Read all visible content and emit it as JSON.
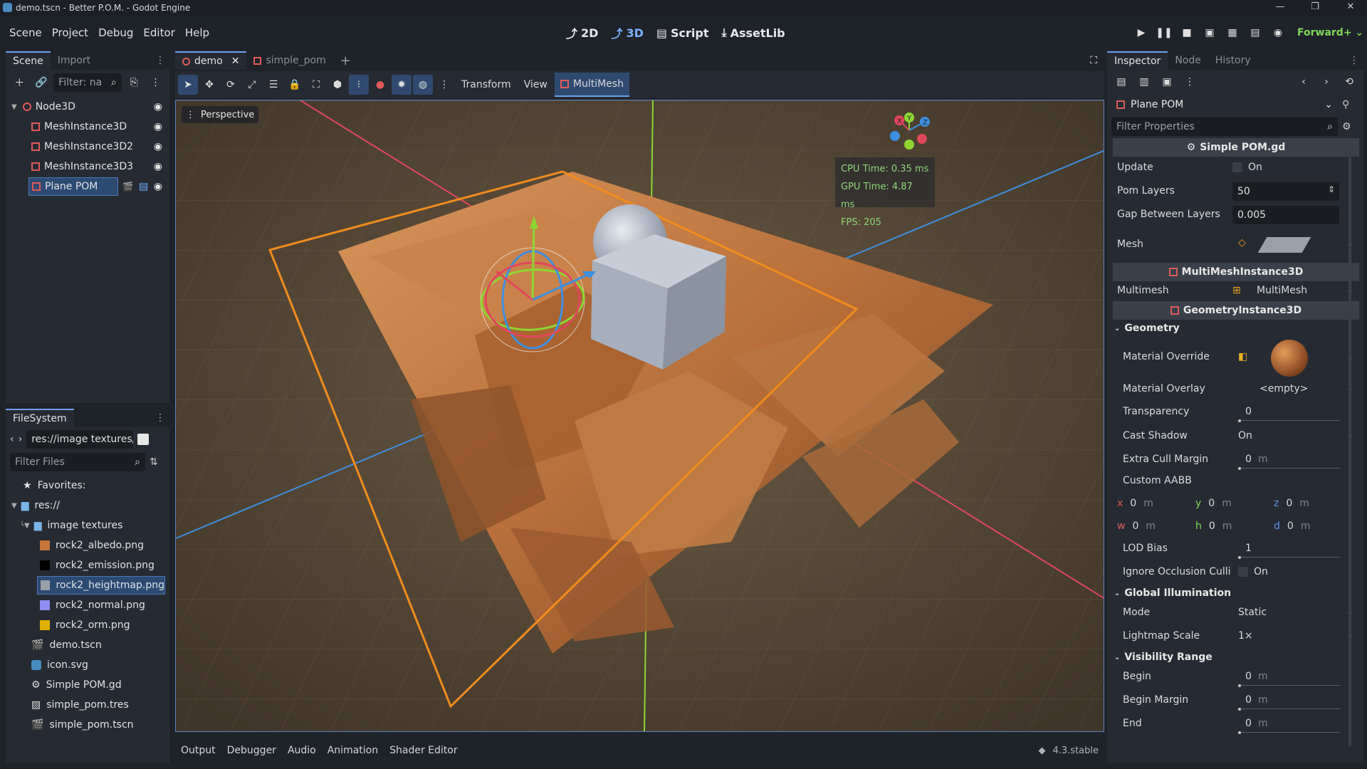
{
  "window": {
    "title": "demo.tscn - Better P.O.M. - Godot Engine"
  },
  "menu": [
    "Scene",
    "Project",
    "Debug",
    "Editor",
    "Help"
  ],
  "workspaces": [
    {
      "label": "2D",
      "active": false
    },
    {
      "label": "3D",
      "active": true
    },
    {
      "label": "Script",
      "active": false
    },
    {
      "label": "AssetLib",
      "active": false
    }
  ],
  "renderer": "Forward+",
  "scene_dock": {
    "tabs": [
      "Scene",
      "Import"
    ],
    "filter_placeholder": "Filter: na",
    "tree": [
      {
        "label": "Node3D",
        "icon": "node3d-icon"
      },
      {
        "label": "MeshInstance3D",
        "icon": "mesh-instance-icon"
      },
      {
        "label": "MeshInstance3D2",
        "icon": "mesh-instance-icon"
      },
      {
        "label": "MeshInstance3D3",
        "icon": "mesh-instance-icon"
      },
      {
        "label": "Plane POM",
        "icon": "multimesh-instance-icon",
        "selected": true
      }
    ]
  },
  "filesystem": {
    "tab": "FileSystem",
    "path": "res://image textures/r",
    "filter_placeholder": "Filter Files",
    "favorites": "Favorites:",
    "root": "res://",
    "folder": "image textures",
    "files": [
      {
        "label": "rock2_albedo.png",
        "icon": "texture-albedo-icon",
        "color": "#c5743a"
      },
      {
        "label": "rock2_emission.png",
        "icon": "texture-emission-icon",
        "color": "#000000"
      },
      {
        "label": "rock2_heightmap.png",
        "icon": "texture-heightmap-icon",
        "color": "#9aa0a8",
        "selected": true
      },
      {
        "label": "rock2_normal.png",
        "icon": "texture-normal-icon",
        "color": "#8f8cf2"
      },
      {
        "label": "rock2_orm.png",
        "icon": "texture-orm-icon",
        "color": "#e0b000"
      }
    ],
    "root_files": [
      {
        "label": "demo.tscn",
        "icon": "scene-file-icon"
      },
      {
        "label": "icon.svg",
        "icon": "svg-file-icon"
      },
      {
        "label": "Simple POM.gd",
        "icon": "gear-icon"
      },
      {
        "label": "simple_pom.tres",
        "icon": "resource-file-icon"
      },
      {
        "label": "simple_pom.tscn",
        "icon": "scene-file-icon"
      }
    ]
  },
  "editor_tabs": [
    {
      "label": "demo",
      "active": true
    },
    {
      "label": "simple_pom",
      "active": false
    }
  ],
  "viewport_toolbar": {
    "menus": [
      "Transform",
      "View"
    ],
    "multimesh": "MultiMesh"
  },
  "viewport": {
    "label": "Perspective",
    "stats": [
      "CPU Time: 0.35 ms",
      "GPU Time: 4.87 ms",
      "FPS: 205"
    ],
    "gizmo_axes": [
      "Y",
      "Z",
      "X"
    ]
  },
  "bottom_panel": {
    "tabs": [
      "Output",
      "Debugger",
      "Audio",
      "Animation",
      "Shader Editor"
    ],
    "version": "4.3.stable"
  },
  "inspector": {
    "tabs": [
      "Inspector",
      "Node",
      "History"
    ],
    "object": "Plane POM",
    "filter_placeholder": "Filter Properties",
    "script_header": "Simple POM.gd",
    "update": {
      "label": "Update",
      "value": "On"
    },
    "pom_layers": {
      "label": "Pom Layers",
      "value": "50"
    },
    "gap": {
      "label": "Gap Between Layers",
      "value": "0.005"
    },
    "mesh": {
      "label": "Mesh"
    },
    "multimesh_header": "MultiMeshInstance3D",
    "multimesh": {
      "label": "Multimesh",
      "value": "MultiMesh"
    },
    "geometry_header": "GeometryInstance3D",
    "geometry": "Geometry",
    "material_override": {
      "label": "Material Override"
    },
    "material_overlay": {
      "label": "Material Overlay",
      "value": "<empty>"
    },
    "transparency": {
      "label": "Transparency",
      "value": "0"
    },
    "cast_shadow": {
      "label": "Cast Shadow",
      "value": "On"
    },
    "extra_cull": {
      "label": "Extra Cull Margin",
      "value": "0",
      "unit": "m"
    },
    "custom_aabb": {
      "label": "Custom AABB"
    },
    "aabb": [
      {
        "axis": "x",
        "value": "0",
        "unit": "m",
        "color": "#e05a5a"
      },
      {
        "axis": "y",
        "value": "0",
        "unit": "m",
        "color": "#7ed957"
      },
      {
        "axis": "z",
        "value": "0",
        "unit": "m",
        "color": "#5a8fe0"
      },
      {
        "axis": "w",
        "value": "0",
        "unit": "m",
        "color": "#e05a5a"
      },
      {
        "axis": "h",
        "value": "0",
        "unit": "m",
        "color": "#7ed957"
      },
      {
        "axis": "d",
        "value": "0",
        "unit": "m",
        "color": "#5a8fe0"
      }
    ],
    "lod_bias": {
      "label": "LOD Bias",
      "value": "1"
    },
    "ignore_occlusion": {
      "label": "Ignore Occlusion Culli",
      "value": "On"
    },
    "gi_header": "Global Illumination",
    "mode": {
      "label": "Mode",
      "value": "Static"
    },
    "lightmap_scale": {
      "label": "Lightmap Scale",
      "value": "1×"
    },
    "visibility_header": "Visibility Range",
    "begin": {
      "label": "Begin",
      "value": "0",
      "unit": "m"
    },
    "begin_margin": {
      "label": "Begin Margin",
      "value": "0",
      "unit": "m"
    },
    "end": {
      "label": "End",
      "value": "0",
      "unit": "m"
    }
  }
}
